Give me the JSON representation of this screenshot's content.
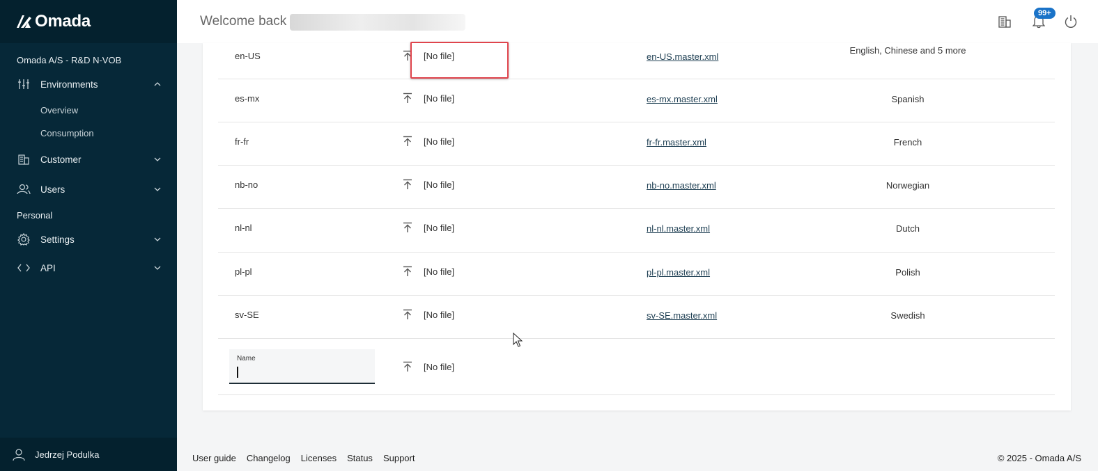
{
  "app": {
    "brand": "Omada"
  },
  "header": {
    "welcome": "Welcome back ."
  },
  "sidebar": {
    "org": "Omada A/S - R&D N-VOB",
    "environments": {
      "label": "Environments",
      "items": [
        "Overview",
        "Consumption"
      ]
    },
    "customer": "Customer",
    "users": "Users",
    "personal": "Personal",
    "settings": "Settings",
    "api": "API",
    "user_name": "Jedrzej Podulka"
  },
  "notifications": {
    "badge": "99+"
  },
  "table": {
    "rows": [
      {
        "name": "en-US",
        "file": "[No file]",
        "link": "en-US.master.xml",
        "languages": "English, Chinese and 5 more"
      },
      {
        "name": "es-mx",
        "file": "[No file]",
        "link": "es-mx.master.xml",
        "languages": "Spanish"
      },
      {
        "name": "fr-fr",
        "file": "[No file]",
        "link": "fr-fr.master.xml",
        "languages": "French"
      },
      {
        "name": "nb-no",
        "file": "[No file]",
        "link": "nb-no.master.xml",
        "languages": "Norwegian"
      },
      {
        "name": "nl-nl",
        "file": "[No file]",
        "link": "nl-nl.master.xml",
        "languages": "Dutch"
      },
      {
        "name": "pl-pl",
        "file": "[No file]",
        "link": "pl-pl.master.xml",
        "languages": "Polish"
      },
      {
        "name": "sv-SE",
        "file": "[No file]",
        "link": "sv-SE.master.xml",
        "languages": "Swedish"
      }
    ],
    "new_row": {
      "name_label": "Name",
      "name_value": "",
      "file": "[No file]"
    }
  },
  "footer": {
    "links": [
      "User guide",
      "Changelog",
      "Licenses",
      "Status",
      "Support"
    ],
    "copyright": "© 2025 - Omada A/S"
  },
  "colors": {
    "sidebar": "#062838",
    "sidebar_dark": "#04212e",
    "badge": "#1a73c8",
    "highlight": "#e0444c"
  }
}
